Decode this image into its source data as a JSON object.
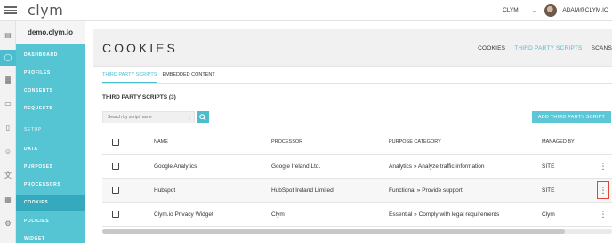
{
  "topbar": {
    "logo": "clym",
    "org": "CLYM",
    "user": "ADAM@CLYM.IO"
  },
  "sidebar": {
    "site": "demo.clym.io",
    "items": [
      {
        "label": "DASHBOARD"
      },
      {
        "label": "PROFILES"
      },
      {
        "label": "CONSENTS"
      },
      {
        "label": "REQUESTS"
      },
      {
        "label": "SETUP"
      },
      {
        "label": "DATA"
      },
      {
        "label": "PURPOSES"
      },
      {
        "label": "PROCESSORS"
      },
      {
        "label": "COOKIES"
      },
      {
        "label": "POLICIES"
      },
      {
        "label": "WIDGET"
      }
    ]
  },
  "header": {
    "title": "COOKIES",
    "tabs": [
      {
        "label": "COOKIES"
      },
      {
        "label": "THIRD PARTY SCRIPTS"
      },
      {
        "label": "SCANS"
      }
    ]
  },
  "subtabs": [
    {
      "label": "THIRD PARTY SCRIPTS"
    },
    {
      "label": "EMBEDDED CONTENT"
    }
  ],
  "section": {
    "title": "THIRD PARTY SCRIPTS (3)"
  },
  "search": {
    "placeholder": "Search by script name"
  },
  "add_button": {
    "label": "ADD THIRD PARTY SCRIPT"
  },
  "table": {
    "columns": [
      "NAME",
      "PROCESSOR",
      "PURPOSE CATEGORY",
      "MANAGED BY"
    ],
    "rows": [
      {
        "name": "Google Analytics",
        "processor": "Google Ireland Ltd.",
        "purpose": "Analytics » Analyze traffic information",
        "managed_by": "SITE"
      },
      {
        "name": "Hubspot",
        "processor": "HubSpot Ireland Limited",
        "purpose": "Functional » Provide support",
        "managed_by": "SITE"
      },
      {
        "name": "Clym.io Privacy Widget",
        "processor": "Clym",
        "purpose": "Essential » Comply with legal requirements",
        "managed_by": "Clym"
      }
    ]
  },
  "colors": {
    "accent": "#4cbccf",
    "sidebar": "#55c4d3",
    "highlight": "#e0473b"
  },
  "icons": [
    "menu-icon",
    "chevron-down-icon",
    "search-icon",
    "more-vertical-icon"
  ]
}
